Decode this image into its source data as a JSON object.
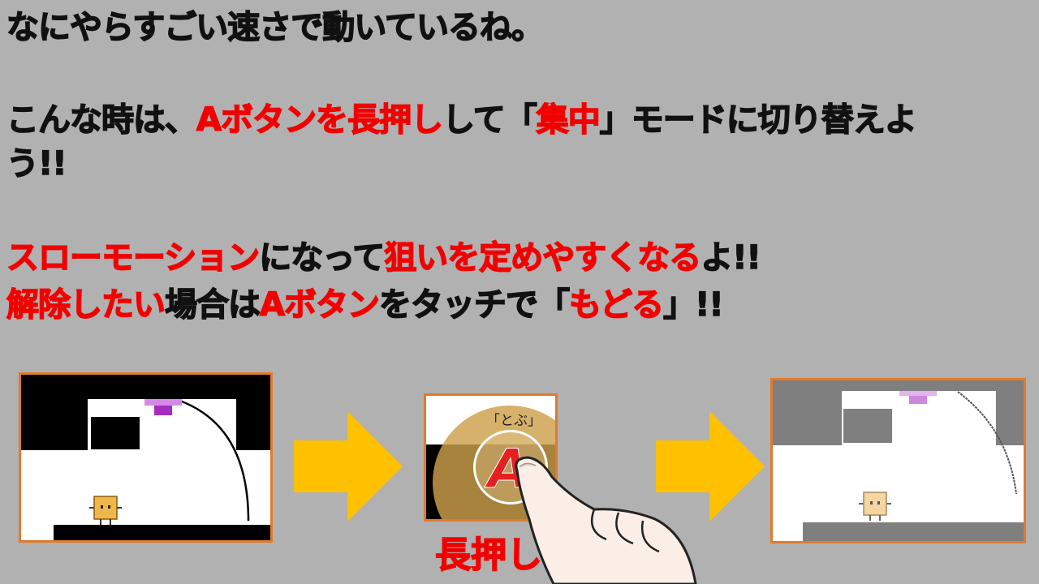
{
  "text": {
    "line1": "なにやらすごい速さで動いているね。",
    "line2": {
      "a": "こんな時は、",
      "b": "Aボタンを長押し",
      "c": "して「",
      "d": "集中",
      "e": "」モードに切り替えよ"
    },
    "line3": "う!!",
    "line4": {
      "a": "スローモーション",
      "b": "になって",
      "c": "狙いを定めやすくなる",
      "d": "よ!!"
    },
    "line5": {
      "a": "解除したい",
      "b": "場合は",
      "c": "Aボタン",
      "d": "をタッチで「",
      "e": "もどる",
      "f": "」!!"
    }
  },
  "illustration": {
    "button_label": "「とぶ」",
    "button_letter": "A",
    "long_press_caption": "長押し"
  },
  "colors": {
    "background": "#b1b1b1",
    "highlight_red": "#f20000",
    "arrow": "#ffc000",
    "panel_border": "#e07a2e",
    "character": "#f0b84a",
    "goal": "#b44ad0"
  }
}
